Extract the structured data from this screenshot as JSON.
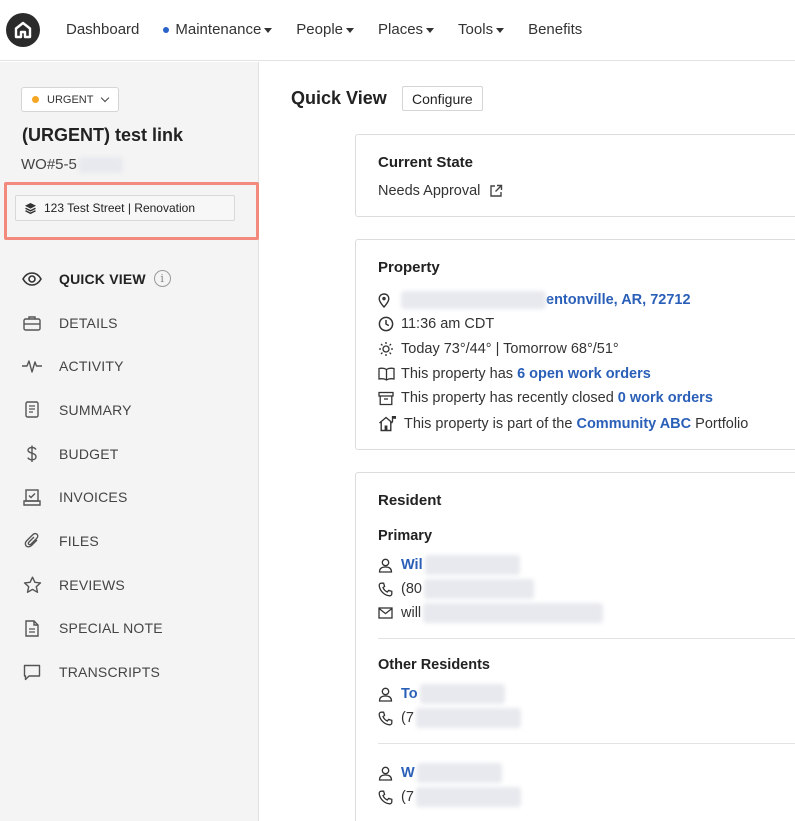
{
  "nav": {
    "items": [
      {
        "label": "Dashboard",
        "dot": false,
        "caret": false
      },
      {
        "label": "Maintenance",
        "dot": true,
        "caret": true
      },
      {
        "label": "People",
        "dot": false,
        "caret": true
      },
      {
        "label": "Places",
        "dot": false,
        "caret": true
      },
      {
        "label": "Tools",
        "dot": false,
        "caret": true
      },
      {
        "label": "Benefits",
        "dot": false,
        "caret": false
      }
    ]
  },
  "sidebar": {
    "priority_label": "URGENT",
    "priority_color": "#f6a623",
    "title": "(URGENT) test link",
    "wo_number": "WO#5-5",
    "property_chip": "123 Test Street | Renovation",
    "menu": [
      {
        "label": "QUICK VIEW",
        "icon": "eye-icon",
        "active": true
      },
      {
        "label": "DETAILS",
        "icon": "briefcase-icon",
        "active": false
      },
      {
        "label": "ACTIVITY",
        "icon": "pulse-icon",
        "active": false
      },
      {
        "label": "SUMMARY",
        "icon": "document-icon",
        "active": false
      },
      {
        "label": "BUDGET",
        "icon": "dollar-icon",
        "active": false
      },
      {
        "label": "INVOICES",
        "icon": "invoice-icon",
        "active": false
      },
      {
        "label": "FILES",
        "icon": "paperclip-icon",
        "active": false
      },
      {
        "label": "REVIEWS",
        "icon": "star-icon",
        "active": false
      },
      {
        "label": "SPECIAL NOTE",
        "icon": "note-icon",
        "active": false
      },
      {
        "label": "TRANSCRIPTS",
        "icon": "chat-icon",
        "active": false
      }
    ]
  },
  "main": {
    "title": "Quick View",
    "configure_label": "Configure",
    "current_state": {
      "heading": "Current State",
      "value": "Needs Approval"
    },
    "property": {
      "heading": "Property",
      "address_visible": "entonville, AR, 72712",
      "time": "11:36 am CDT",
      "weather": "Today 73°/44° | Tomorrow 68°/51°",
      "open_prefix": "This property has ",
      "open_link": "6 open work orders",
      "closed_prefix": "This property has recently closed ",
      "closed_link": "0 work orders",
      "portfolio_prefix": "This property is part of the ",
      "portfolio_link": "Community ABC",
      "portfolio_suffix": " Portfolio"
    },
    "resident": {
      "heading": "Resident",
      "primary_label": "Primary",
      "primary_name": "Wil",
      "primary_phone": "(80",
      "primary_email": "will",
      "other_label": "Other Residents",
      "other1_name": "To",
      "other1_phone": "(7",
      "other2_name": "W",
      "other2_phone": "(7"
    }
  }
}
